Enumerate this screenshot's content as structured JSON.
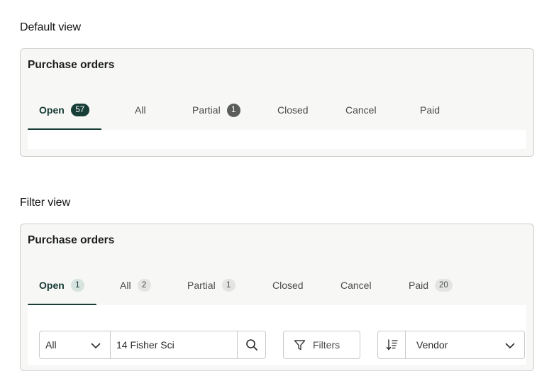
{
  "sections": {
    "default": {
      "heading": "Default view",
      "card_title": "Purchase orders",
      "tabs": [
        {
          "label": "Open",
          "badge": "57"
        },
        {
          "label": "All",
          "badge": ""
        },
        {
          "label": "Partial",
          "badge": "1"
        },
        {
          "label": "Closed",
          "badge": ""
        },
        {
          "label": "Cancel",
          "badge": ""
        },
        {
          "label": "Paid",
          "badge": ""
        }
      ]
    },
    "filter": {
      "heading": "Filter view",
      "card_title": "Purchase orders",
      "tabs": [
        {
          "label": "Open",
          "badge": "1"
        },
        {
          "label": "All",
          "badge": "2"
        },
        {
          "label": "Partial",
          "badge": "1"
        },
        {
          "label": "Closed",
          "badge": ""
        },
        {
          "label": "Cancel",
          "badge": ""
        },
        {
          "label": "Paid",
          "badge": "20"
        }
      ],
      "toolbar": {
        "scope_value": "All",
        "search_value": "14 Fisher Sci",
        "filters_label": "Filters",
        "sort_value": "Vendor"
      }
    }
  },
  "colors": {
    "accent": "#163d36",
    "card_bg": "#f7f7f6",
    "border": "#cfd0cd"
  },
  "icons": [
    "chevron-down-icon",
    "search-icon",
    "filter-icon",
    "sort-icon"
  ]
}
